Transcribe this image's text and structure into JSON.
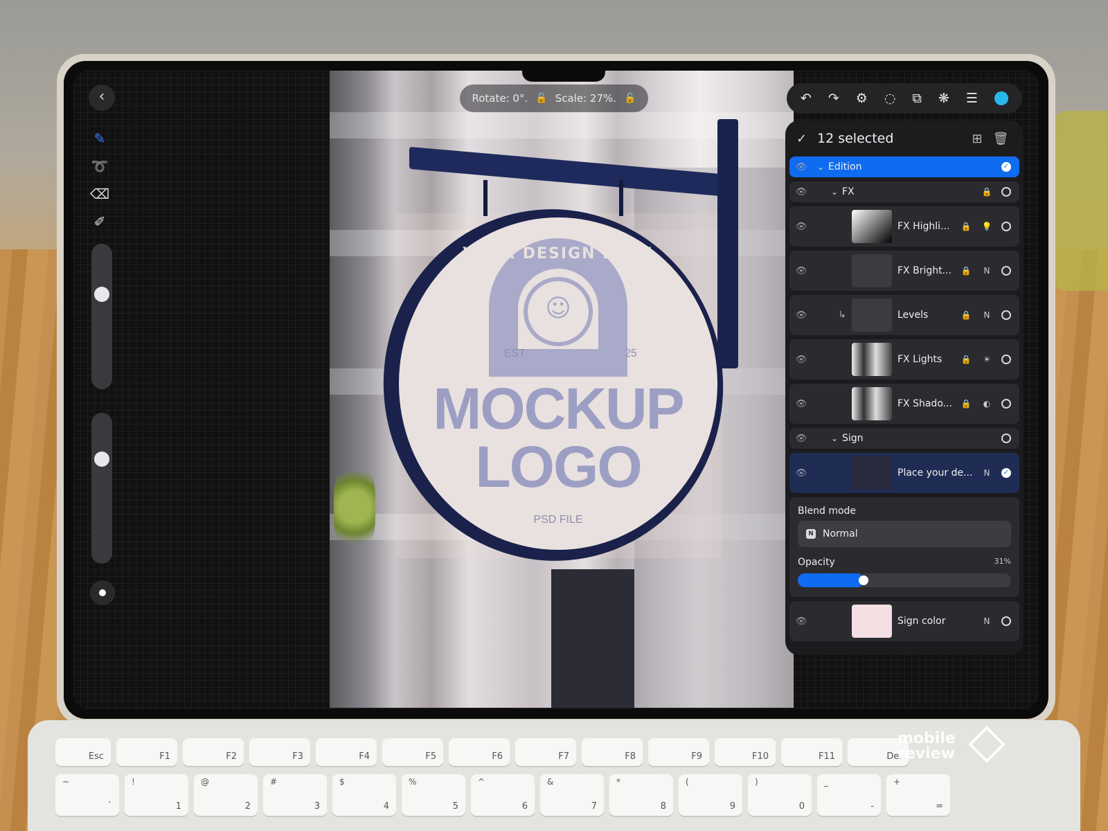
{
  "canvas": {
    "transform": {
      "rotate": "Rotate: 0°.",
      "scale": "Scale: 27%."
    },
    "sign": {
      "arc_text": "YOUR DESIGN HERE",
      "est": "EST",
      "year": "25",
      "line1": "MOCKUP",
      "line2": "LOGO",
      "footer": "PSD FILE"
    }
  },
  "toolbar": {
    "undo": "↶",
    "redo": "↷",
    "adjust": "⚙",
    "select": "◌",
    "crop": "⧉",
    "fx": "❋",
    "layers": "☰",
    "accent_color": "#28b7ea"
  },
  "panel": {
    "header": {
      "title": "12 selected"
    },
    "layers": [
      {
        "name": "Edition"
      },
      {
        "name": "FX"
      },
      {
        "name": "FX Highli..."
      },
      {
        "name": "FX Bright..."
      },
      {
        "name": "Levels"
      },
      {
        "name": "FX Lights"
      },
      {
        "name": "FX Shado..."
      },
      {
        "name": "Sign"
      },
      {
        "name": "Place your de..."
      },
      {
        "name": "Sign color"
      }
    ],
    "blend": {
      "label": "Blend mode",
      "value": "Normal",
      "opacity_label": "Opacity",
      "opacity_value": "31%",
      "opacity": 0.31
    }
  },
  "keyboard": {
    "row1": [
      "Esc",
      "F1",
      "F2",
      "F3",
      "F4",
      "F5",
      "F6",
      "F7",
      "F8",
      "F9",
      "F10",
      "F11",
      "Del"
    ],
    "row2": [
      {
        "top": "~",
        "main": "`"
      },
      {
        "top": "!",
        "main": "1"
      },
      {
        "top": "@",
        "main": "2"
      },
      {
        "top": "#",
        "main": "3"
      },
      {
        "top": "$",
        "main": "4"
      },
      {
        "top": "%",
        "main": "5"
      },
      {
        "top": "^",
        "main": "6"
      },
      {
        "top": "&",
        "main": "7"
      },
      {
        "top": "*",
        "main": "8"
      },
      {
        "top": "(",
        "main": "9"
      },
      {
        "top": ")",
        "main": "0"
      },
      {
        "top": "_",
        "main": "-"
      },
      {
        "top": "+",
        "main": "="
      }
    ]
  },
  "watermark": {
    "line1": "mobile",
    "line2": "review"
  }
}
